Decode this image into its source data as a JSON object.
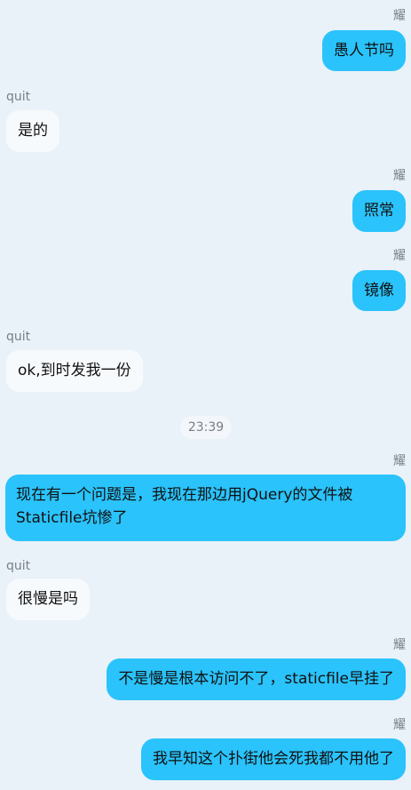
{
  "messages": [
    {
      "sender": "耀",
      "text": "愚人节吗",
      "direction": "out"
    },
    {
      "sender": "quit",
      "text": "是的",
      "direction": "in"
    },
    {
      "sender": "耀",
      "text": "照常",
      "direction": "out"
    },
    {
      "sender": "耀",
      "text": "镜像",
      "direction": "out"
    },
    {
      "sender": "quit",
      "text": "ok,到时发我一份",
      "direction": "in"
    },
    {
      "sender": "耀",
      "text": "现在有一个问题是，我现在那边用jQuery的文件被Staticfile坑惨了",
      "direction": "out"
    },
    {
      "sender": "quit",
      "text": "很慢是吗",
      "direction": "in"
    },
    {
      "sender": "耀",
      "text": "不是慢是根本访问不了，staticfile早挂了",
      "direction": "out"
    },
    {
      "sender": "耀",
      "text": "我早知这个扑街他会死我都不用他了",
      "direction": "out"
    }
  ],
  "time_divider": "23:39",
  "colors": {
    "background": "#e9f1f9",
    "outgoing_bubble": "#2ac3fb",
    "incoming_bubble": "#f7fafd",
    "sender_text": "#7a7f85"
  }
}
